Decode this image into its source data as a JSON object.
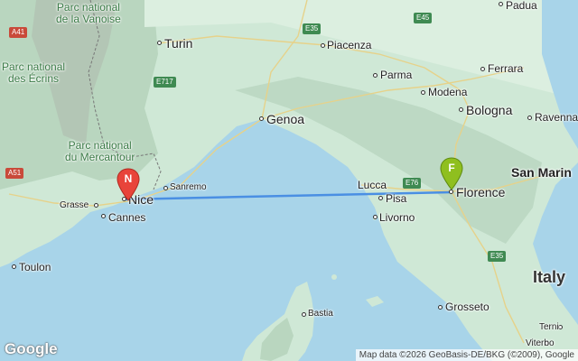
{
  "map": {
    "provider_logo": "Google",
    "attribution": "Map data ©2026 GeoBasis-DE/BKG (©2009), Google",
    "colors": {
      "sea": "#a8d4e9",
      "land": "#cfe8d6",
      "route": "#4a8fe3",
      "marker_n": "#e8443a",
      "marker_f": "#8fbf1f"
    }
  },
  "markers": [
    {
      "letter": "N",
      "color": "#e8443a"
    },
    {
      "letter": "F",
      "color": "#8fbf1f"
    }
  ],
  "cities": {
    "padua": "Padua",
    "turin": "Turin",
    "piacenza": "Piacenza",
    "parma": "Parma",
    "ferrara": "Ferrara",
    "modena": "Modena",
    "bologna": "Bologna",
    "ravenna": "Ravenna",
    "genoa": "Genoa",
    "san_marino": "San Marin",
    "lucca": "Lucca",
    "pisa": "Pisa",
    "florence": "Florence",
    "livorno": "Livorno",
    "sanremo": "Sanremo",
    "nice": "Nice",
    "grasse": "Grasse",
    "cannes": "Cannes",
    "toulon": "Toulon",
    "bastia": "Bastia",
    "grosseto": "Grosseto",
    "italy": "Italy",
    "terni": "Terni",
    "viterbo": "Viterbo"
  },
  "parks": {
    "vanoise": "Parc national\nde la Vanoise",
    "ecrins": "Parc national\ndes Écrins",
    "mercantour": "Parc national\ndu Mercantour"
  },
  "roads": {
    "a41": "A41",
    "a51": "A51",
    "e35_north": "E35",
    "e45": "E45",
    "e717": "E717",
    "e76": "E76",
    "e35_south": "E35"
  }
}
